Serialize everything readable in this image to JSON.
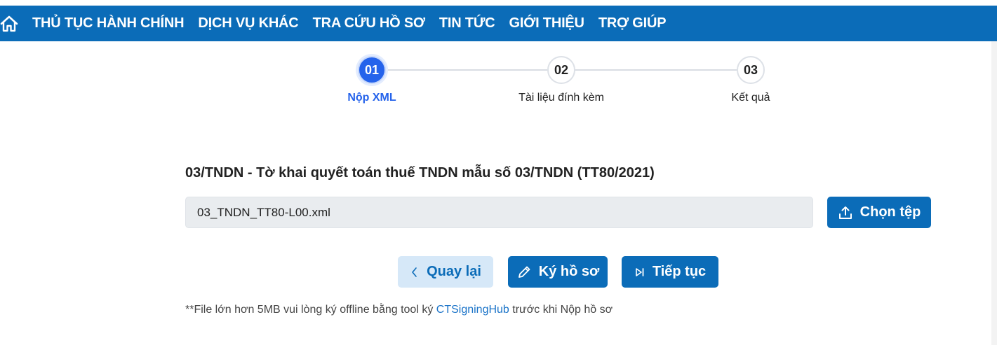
{
  "nav": {
    "home_icon": "home-icon",
    "items": [
      {
        "label": "THỦ TỤC HÀNH CHÍNH"
      },
      {
        "label": "DỊCH VỤ KHÁC"
      },
      {
        "label": "TRA CỨU HỒ SƠ"
      },
      {
        "label": "TIN TỨC"
      },
      {
        "label": "GIỚI THIỆU"
      },
      {
        "label": "TRỢ GIÚP"
      }
    ],
    "color": "#0b6cb8"
  },
  "stepper": {
    "steps": [
      {
        "number": "01",
        "label": "Nộp XML",
        "active": true
      },
      {
        "number": "02",
        "label": "Tài liệu đính kèm",
        "active": false
      },
      {
        "number": "03",
        "label": "Kết quả",
        "active": false
      }
    ],
    "active_color": "#2563eb"
  },
  "form": {
    "title": "03/TNDN - Tờ khai quyết toán thuế TNDN mẫu số 03/TNDN (TT80/2021)",
    "file_value": "03_TNDN_TT80-L00.xml",
    "choose_label": "Chọn tệp",
    "choose_icon": "upload-icon"
  },
  "actions": {
    "back_label": "Quay lại",
    "back_icon": "chevron-left-icon",
    "sign_label": "Ký hồ sơ",
    "sign_icon": "pencil-icon",
    "next_label": "Tiếp tục",
    "next_icon": "skip-next-icon"
  },
  "note": {
    "prefix": "**File lớn hơn 5MB vui lòng ký offline bằng tool ký ",
    "link": "CTSigningHub",
    "suffix": " trước khi Nộp hồ sơ"
  }
}
